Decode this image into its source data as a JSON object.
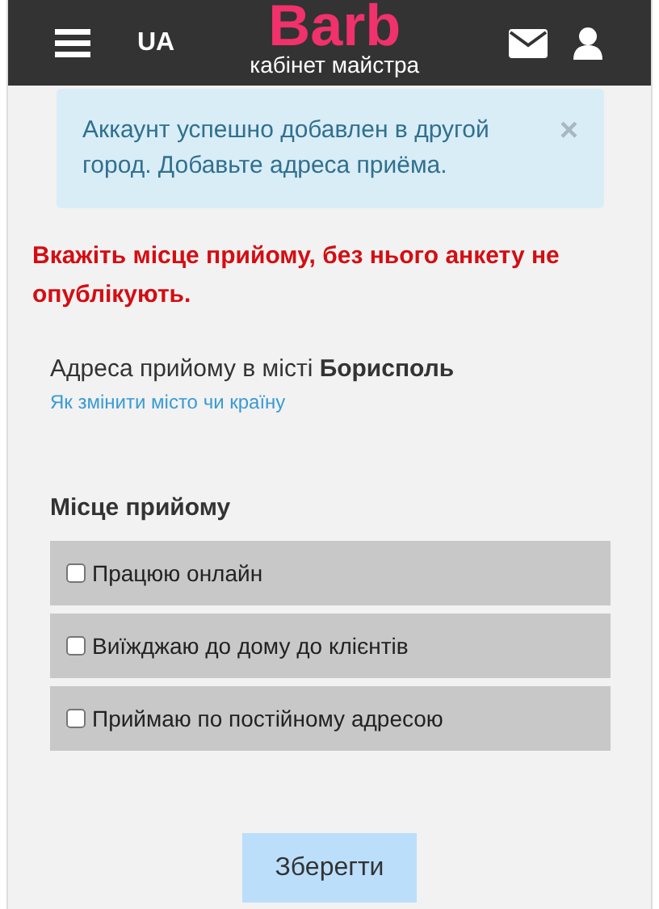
{
  "header": {
    "language": "UA",
    "logo": "Barb",
    "subtitle": "кабінет майстра"
  },
  "alert": {
    "text": "Аккаунт успешно добавлен в другой город. Добавьте адреса приёма.",
    "close": "×"
  },
  "warning": "Вкажіть місце прийому, без нього анкету не опублікують.",
  "address": {
    "text": "Адреса прийому в місті **Борисполь**",
    "link": "Як змінити місто чи країну"
  },
  "section_title": "Місце прийому",
  "options": [
    {
      "label": "Працюю онлайн",
      "checked": false
    },
    {
      "label": "Виїжджаю до дому до клієнтів",
      "checked": false
    },
    {
      "label": "Приймаю по постійному адресою",
      "checked": false
    }
  ],
  "save_button": "Зберегти"
}
